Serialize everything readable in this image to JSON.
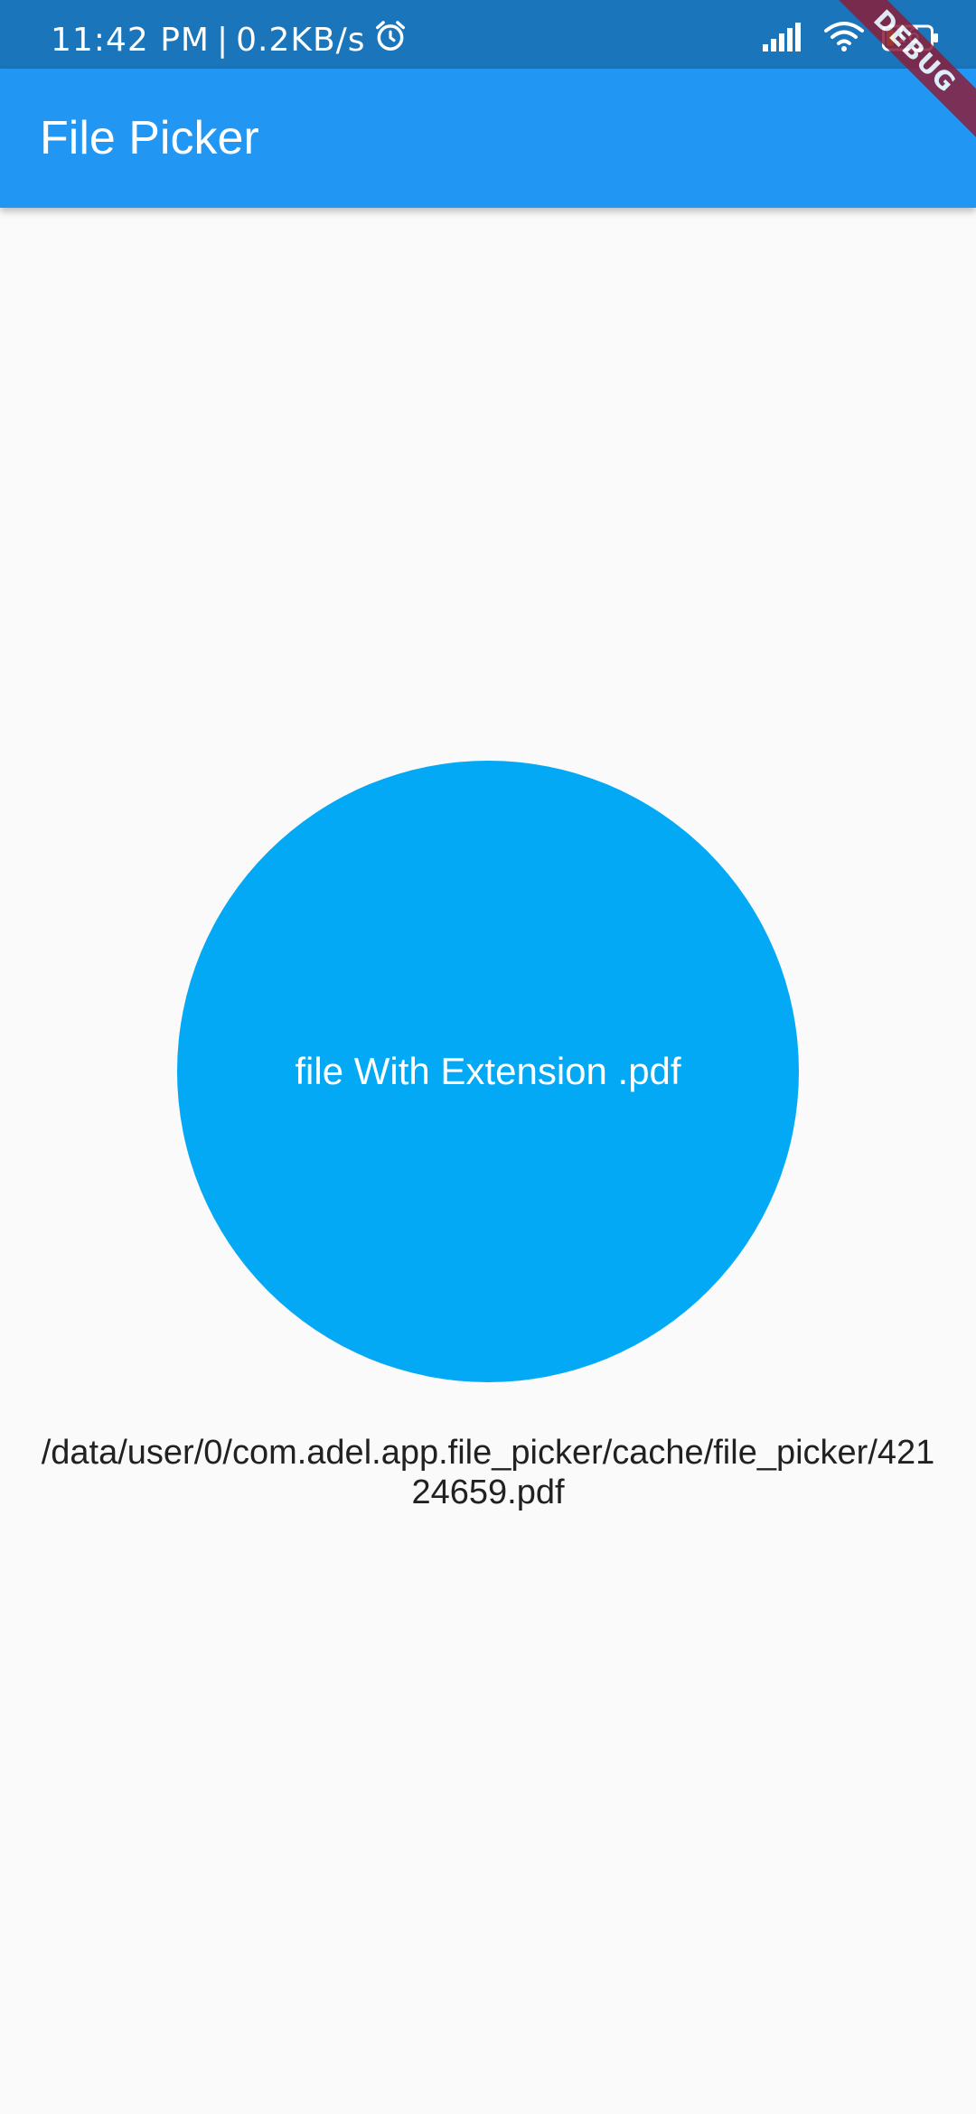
{
  "status_bar": {
    "time": "11:42 PM",
    "separator": "|",
    "net_speed": "0.2KB/s",
    "alarm_icon": "alarm-icon",
    "signal_icon": "signal-icon",
    "wifi_icon": "wifi-icon",
    "battery_icon": "battery-icon",
    "battery_level": "16"
  },
  "app_bar": {
    "title": "File Picker",
    "color": "#2196f3"
  },
  "debug_banner": {
    "label": "DEBUG"
  },
  "main": {
    "pick_button_label": "file With Extension .pdf",
    "pick_button_color": "#03a9f4",
    "file_path": "/data/user/0/com.adel.app.file_picker/cache/file_picker/42124659.pdf"
  }
}
